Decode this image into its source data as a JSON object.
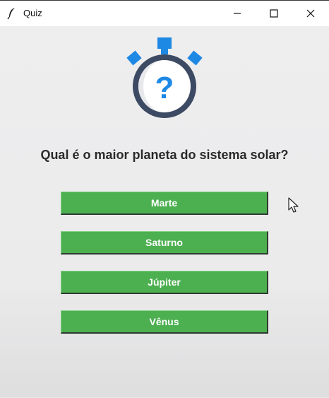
{
  "window": {
    "title": "Quiz",
    "app_icon": "feather-icon",
    "controls": [
      "minimize-icon",
      "maximize-icon",
      "close-icon"
    ]
  },
  "quiz": {
    "illustration": "stopwatch-question-icon",
    "illustration_glyph": "?",
    "question": "Qual é o maior planeta do sistema solar?",
    "options": [
      "Marte",
      "Saturno",
      "Júpiter",
      "Vênus"
    ]
  },
  "colors": {
    "answer_button": "#4caf50",
    "stopwatch_blue": "#1e88e5",
    "stopwatch_ring": "#3d4a63",
    "background": "#ebebec"
  }
}
